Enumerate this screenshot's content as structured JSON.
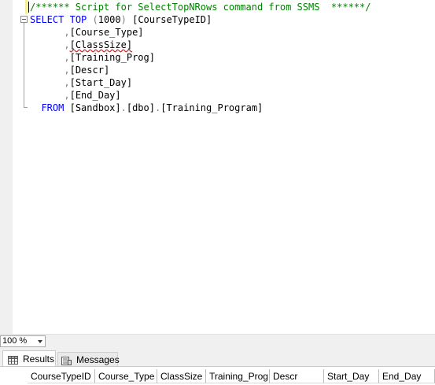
{
  "editor": {
    "lines": [
      {
        "comment": "/****** Script for SelectTopNRows command from SSMS  ******/"
      },
      {
        "kw1": "SELECT",
        "kw2": "TOP",
        "p1": " (",
        "num": "1000",
        "p2": ") ",
        "col": "[CourseTypeID]"
      },
      {
        "comma": ",",
        "col": "[Course_Type]"
      },
      {
        "comma": ",",
        "col": "[ClassSize]"
      },
      {
        "comma": ",",
        "col": "[Training_Prog]"
      },
      {
        "comma": ",",
        "col": "[Descr]"
      },
      {
        "comma": ",",
        "col": "[Start_Day]"
      },
      {
        "comma": ",",
        "col": "[End_Day]"
      },
      {
        "kw": "FROM",
        "db": "[Sandbox]",
        "dot1": ".",
        "schema": "[dbo]",
        "dot2": ".",
        "table": "[Training_Program]"
      }
    ]
  },
  "zoom": {
    "value": "100 %"
  },
  "tabs": {
    "results": {
      "label": "Results"
    },
    "messages": {
      "label": "Messages"
    }
  },
  "results": {
    "columns": [
      "CourseTypeID",
      "Course_Type",
      "ClassSize",
      "Training_Prog",
      "Descr",
      "Start_Day",
      "End_Day"
    ]
  }
}
